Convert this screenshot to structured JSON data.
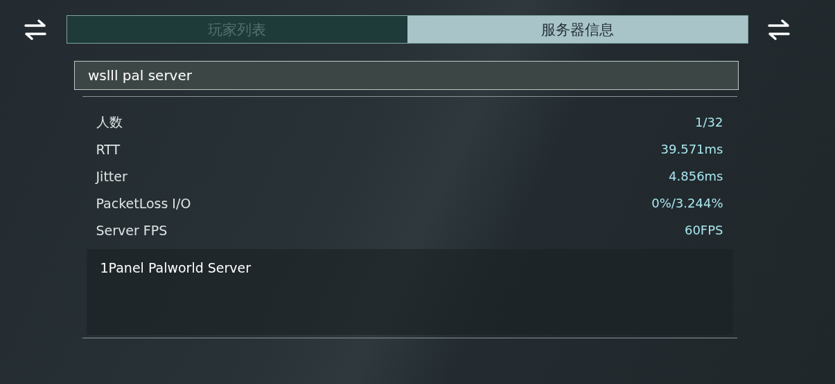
{
  "tabs": [
    {
      "label": "玩家列表",
      "selected": false
    },
    {
      "label": "服务器信息",
      "selected": true
    }
  ],
  "server_name": "wslll pal server",
  "stats": [
    {
      "label": "人数",
      "value": "1/32"
    },
    {
      "label": "RTT",
      "value": "39.571ms"
    },
    {
      "label": "Jitter",
      "value": "4.856ms"
    },
    {
      "label": "PacketLoss I/O",
      "value": "0%/3.244%"
    },
    {
      "label": "Server FPS",
      "value": "60FPS"
    }
  ],
  "description": "1Panel Palworld Server"
}
